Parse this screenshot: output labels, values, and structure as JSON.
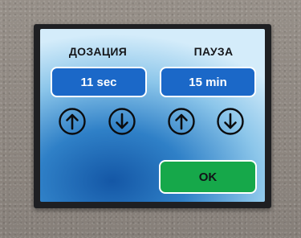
{
  "dosing": {
    "label": "ДОЗАЦИЯ",
    "value": "11 sec",
    "up_icon": "arrow-up-circle",
    "down_icon": "arrow-down-circle"
  },
  "pause": {
    "label": "ПАУЗА",
    "value": "15 min",
    "up_icon": "arrow-up-circle",
    "down_icon": "arrow-down-circle"
  },
  "ok_button": {
    "label": "OK"
  },
  "colors": {
    "value_box": "#1b68c8",
    "ok_button": "#16a84a",
    "screen_dark": "#1457a6",
    "screen_light": "#d4ecfa",
    "bezel": "#1e1f22"
  }
}
